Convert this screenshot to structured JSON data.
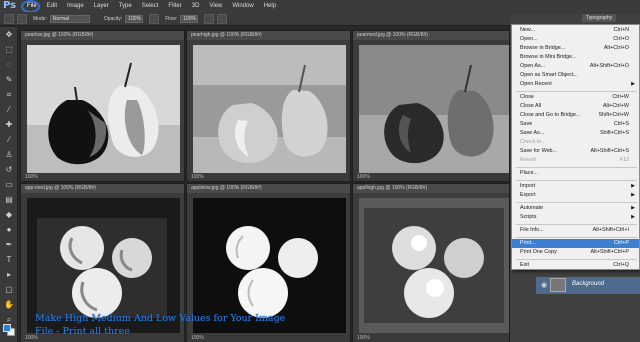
{
  "menubar": {
    "logo": "Ps",
    "items": [
      "File",
      "Edit",
      "Image",
      "Layer",
      "Type",
      "Select",
      "Filter",
      "3D",
      "View",
      "Window",
      "Help"
    ]
  },
  "options": {
    "mode_label": "Mode:",
    "mode_value": "Normal",
    "opacity_label": "Opacity:",
    "opacity_value": "100%",
    "flow_label": "Flow:",
    "flow_value": "100%"
  },
  "documents": [
    {
      "tab": "pearlow.jpg @ 100% (RGB/8#)",
      "status": "100%"
    },
    {
      "tab": "pearhigh.jpg @ 100% (RGB/8#)",
      "status": "100%"
    },
    {
      "tab": "pearmed.jpg @ 100% (RGB/8#)",
      "status": "100%"
    },
    {
      "tab": "app-med.jpg @ 100% (RGB/8#)",
      "status": "100%"
    },
    {
      "tab": "applelow.jpg @ 100% (RGB/8#)",
      "status": "100%"
    },
    {
      "tab": "applhigh.jpg @ 100% (RGB/8#)",
      "status": "100%"
    }
  ],
  "panel": {
    "typography_tab": "Typography",
    "layer_name": "Background"
  },
  "file_menu": {
    "items": [
      {
        "label": "New...",
        "shortcut": "Ctrl+N"
      },
      {
        "label": "Open...",
        "shortcut": "Ctrl+O"
      },
      {
        "label": "Browse in Bridge...",
        "shortcut": "Alt+Ctrl+O"
      },
      {
        "label": "Browse in Mini Bridge...",
        "shortcut": ""
      },
      {
        "label": "Open As...",
        "shortcut": "Alt+Shift+Ctrl+O"
      },
      {
        "label": "Open as Smart Object...",
        "shortcut": ""
      },
      {
        "label": "Open Recent",
        "shortcut": ""
      },
      {
        "label": "Close",
        "shortcut": "Ctrl+W"
      },
      {
        "label": "Close All",
        "shortcut": "Alt+Ctrl+W"
      },
      {
        "label": "Close and Go to Bridge...",
        "shortcut": "Shift+Ctrl+W"
      },
      {
        "label": "Save",
        "shortcut": "Ctrl+S"
      },
      {
        "label": "Save As...",
        "shortcut": "Shift+Ctrl+S"
      },
      {
        "label": "Check In...",
        "shortcut": ""
      },
      {
        "label": "Save for Web...",
        "shortcut": "Alt+Shift+Ctrl+S"
      },
      {
        "label": "Revert",
        "shortcut": "F12"
      },
      {
        "label": "Place...",
        "shortcut": ""
      },
      {
        "label": "Import",
        "shortcut": ""
      },
      {
        "label": "Export",
        "shortcut": ""
      },
      {
        "label": "Automate",
        "shortcut": ""
      },
      {
        "label": "Scripts",
        "shortcut": ""
      },
      {
        "label": "File Info...",
        "shortcut": "Alt+Shift+Ctrl+I"
      },
      {
        "label": "Print...",
        "shortcut": "Ctrl+P"
      },
      {
        "label": "Print One Copy",
        "shortcut": "Alt+Shift+Ctrl+P"
      },
      {
        "label": "Exit",
        "shortcut": "Ctrl+Q"
      }
    ]
  },
  "caption": {
    "line1": "Make High Medium And Low Values for Your Image",
    "line2": "File - Print all three"
  },
  "colors": {
    "accent": "#2d7fe6",
    "highlight": "#3f7fd0",
    "foreground_swatch": "#2a80e0"
  }
}
